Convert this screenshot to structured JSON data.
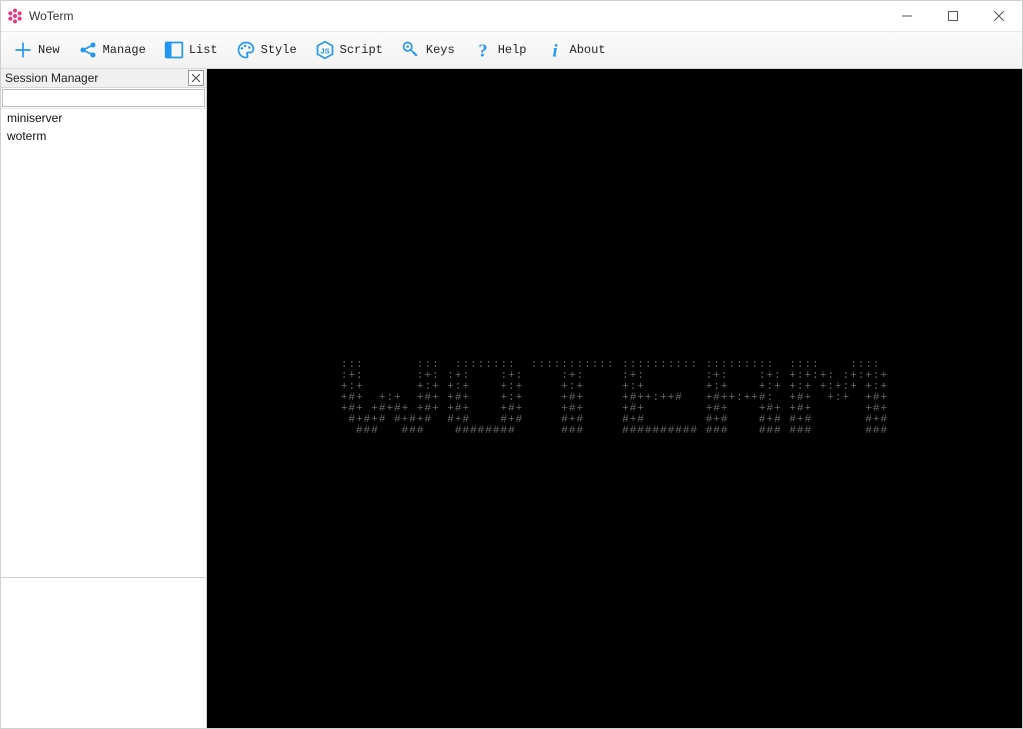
{
  "app": {
    "title": "WoTerm"
  },
  "toolbar": {
    "items": [
      {
        "id": "new",
        "label": "New",
        "icon": "plus-icon"
      },
      {
        "id": "manage",
        "label": "Manage",
        "icon": "share-icon"
      },
      {
        "id": "list",
        "label": "List",
        "icon": "list-panel-icon"
      },
      {
        "id": "style",
        "label": "Style",
        "icon": "palette-icon"
      },
      {
        "id": "script",
        "label": "Script",
        "icon": "js-icon"
      },
      {
        "id": "keys",
        "label": "Keys",
        "icon": "key-icon"
      },
      {
        "id": "help",
        "label": "Help",
        "icon": "question-icon"
      },
      {
        "id": "about",
        "label": "About",
        "icon": "info-icon"
      }
    ]
  },
  "sidebar": {
    "title": "Session Manager",
    "search_value": "",
    "items": [
      {
        "label": "miniserver"
      },
      {
        "label": "woterm"
      }
    ]
  },
  "terminal": {
    "ascii_logo": ":::       :::  ::::::::  ::::::::::: :::::::::: :::::::::  ::::    ::::\n:+:       :+: :+:    :+:     :+:     :+:        :+:    :+: +:+:+: :+:+:+\n+:+       +:+ +:+    +:+     +:+     +:+        +:+    +:+ +:+ +:+:+ +:+\n+#+  +:+  +#+ +#+    +:+     +#+     +#++:++#   +#++:++#:  +#+  +:+  +#+\n+#+ +#+#+ +#+ +#+    +#+     +#+     +#+        +#+    +#+ +#+       +#+\n #+#+# #+#+#  #+#    #+#     #+#     #+#        #+#    #+# #+#       #+#\n  ###   ###    ########      ###     ########## ###    ### ###       ###"
  },
  "colors": {
    "accent": "#2196f3",
    "terminal_bg": "#000000",
    "ascii_fg": "#6a6a6a"
  }
}
